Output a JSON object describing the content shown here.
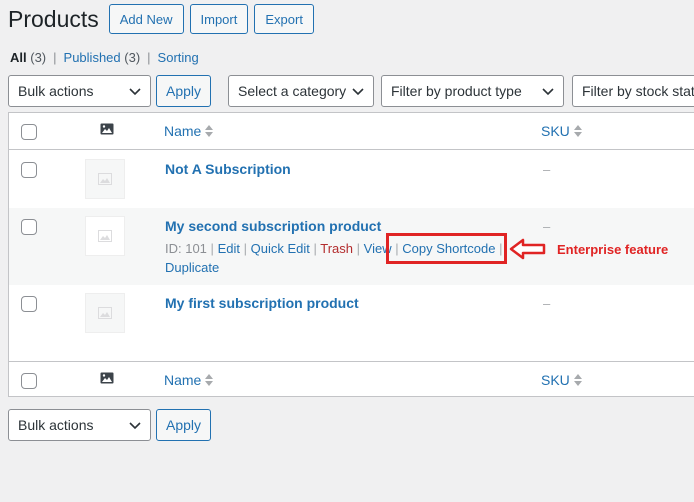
{
  "header": {
    "title": "Products",
    "buttons": [
      "Add New",
      "Import",
      "Export"
    ]
  },
  "views": {
    "all": {
      "label": "All",
      "count": "(3)"
    },
    "published": {
      "label": "Published",
      "count": "(3)"
    },
    "sorting": {
      "label": "Sorting"
    }
  },
  "toolbar": {
    "bulk_actions": "Bulk actions",
    "apply": "Apply",
    "category": "Select a category",
    "product_type": "Filter by product type",
    "stock_status": "Filter by stock stat"
  },
  "columns": {
    "name": "Name",
    "sku": "SKU"
  },
  "rows": [
    {
      "title": "Not A Subscription",
      "sku": "–"
    },
    {
      "title": "My second subscription product",
      "sku": "–"
    },
    {
      "title": "My first subscription product",
      "sku": "–"
    }
  ],
  "row_actions": {
    "id": "ID: 101",
    "edit": "Edit",
    "quick_edit": "Quick Edit",
    "trash": "Trash",
    "view": "View",
    "copy_shortcode": "Copy Shortcode",
    "duplicate": "Duplicate",
    "separator": "|"
  },
  "annotation": {
    "text": "Enterprise feature",
    "color": "#e02424"
  },
  "colors": {
    "link": "#2271b1",
    "trash": "#b32d2e",
    "background": "#f0f0f1"
  }
}
